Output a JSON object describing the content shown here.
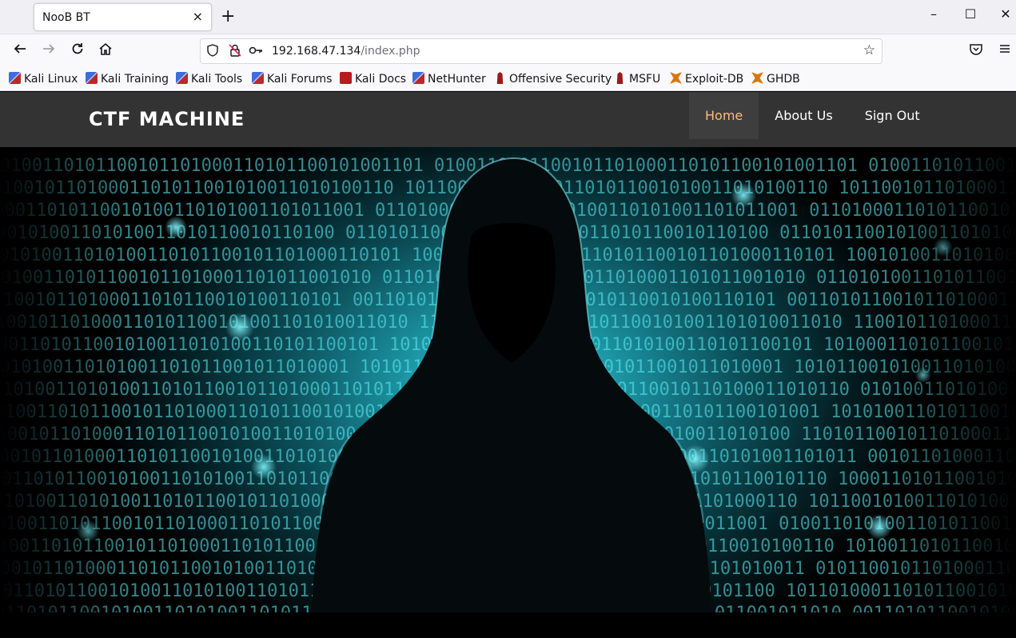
{
  "browser": {
    "tab_title": "NooB BT",
    "tab_close": "×",
    "new_tab": "+",
    "window_controls": {
      "minimize": "–",
      "maximize": "☐",
      "close": "✕"
    },
    "url_host": "192.168.47.134",
    "url_path": "/index.php",
    "icons": [
      "back-icon",
      "forward-icon",
      "reload-icon",
      "home-icon",
      "shield-icon",
      "insecure-lock-icon",
      "key-icon",
      "star-icon",
      "pocket-icon",
      "menu-icon"
    ]
  },
  "bookmarks": [
    {
      "label": "Kali Linux",
      "icon": "kali"
    },
    {
      "label": "Kali Training",
      "icon": "kali"
    },
    {
      "label": "Kali Tools",
      "icon": "kali"
    },
    {
      "label": "Kali Forums",
      "icon": "kali"
    },
    {
      "label": "Kali Docs",
      "icon": "docs"
    },
    {
      "label": "NetHunter",
      "icon": "kali"
    },
    {
      "label": "Offensive Security",
      "icon": "red"
    },
    {
      "label": "MSFU",
      "icon": "red"
    },
    {
      "label": "Exploit-DB",
      "icon": "spider"
    },
    {
      "label": "GHDB",
      "icon": "spider"
    }
  ],
  "site": {
    "brand": "CTF MACHINE",
    "nav": [
      {
        "label": "Home",
        "active": true
      },
      {
        "label": "About Us",
        "active": false
      },
      {
        "label": "Sign Out",
        "active": false
      }
    ]
  },
  "hero": {
    "image_alt": "hooded-hacker-with-binary-code-background",
    "binary_text": "0 1 0 0 1 1 0 1 0 1 1 0 0 1 0 1 1 0 1 0 0 0 1 1 0 1 0 1 1 0 0 1 0 1 0 0 1 1 0 1"
  },
  "colors": {
    "header_bg": "#333333",
    "active_nav_text": "#ffbb77",
    "hero_glow": "#3fd6e4"
  }
}
